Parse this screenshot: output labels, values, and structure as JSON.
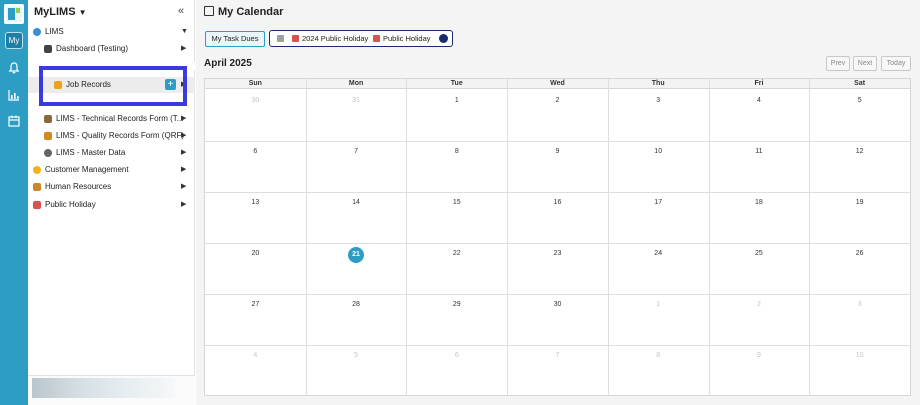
{
  "app": {
    "name": "MyLIMS",
    "rail_my_label": "My",
    "colors": {
      "primary": "#2d9dc4",
      "highlight": "#3a3ae0",
      "holiday_dot": "#1b2a6b"
    },
    "rail_icons": [
      "bell-icon",
      "chart-icon",
      "calendar-icon"
    ]
  },
  "sidebar": {
    "items": [
      {
        "label": "LIMS",
        "icon": "globe-icon"
      },
      {
        "label": "Dashboard (Testing)",
        "icon": "user-icon"
      },
      {
        "label": "Job Records",
        "icon": "warning-icon",
        "add_label": "+"
      },
      {
        "label": "LIMS - Technical Records Form (T...",
        "icon": "tools-icon"
      },
      {
        "label": "LIMS - Quality Records Form (QRF)",
        "icon": "badge-icon"
      },
      {
        "label": "LIMS - Master Data",
        "icon": "gear-icon"
      },
      {
        "label": "Customer Management",
        "icon": "smile-icon"
      },
      {
        "label": "Human Resources",
        "icon": "people-icon"
      },
      {
        "label": "Public Holiday",
        "icon": "calendar-icon"
      }
    ]
  },
  "main": {
    "title": "My Calendar",
    "task_button": "My Task Dues",
    "filter": {
      "label_a": "2024 Public Holiday",
      "label_b": "Public Holiday"
    },
    "month_label": "April 2025",
    "nav": {
      "prev": "Prev",
      "next": "Next",
      "today": "Today"
    }
  },
  "calendar": {
    "weekdays": [
      "Sun",
      "Mon",
      "Tue",
      "Wed",
      "Thu",
      "Fri",
      "Sat"
    ],
    "weeks": [
      [
        "30",
        "31",
        "1",
        "2",
        "3",
        "4",
        "5"
      ],
      [
        "6",
        "7",
        "8",
        "9",
        "10",
        "11",
        "12"
      ],
      [
        "13",
        "14",
        "15",
        "16",
        "17",
        "18",
        "19"
      ],
      [
        "20",
        "21",
        "22",
        "23",
        "24",
        "25",
        "26"
      ],
      [
        "27",
        "28",
        "29",
        "30",
        "1",
        "2",
        "3"
      ],
      [
        "4",
        "5",
        "6",
        "7",
        "8",
        "9",
        "10"
      ]
    ],
    "today": "21"
  }
}
